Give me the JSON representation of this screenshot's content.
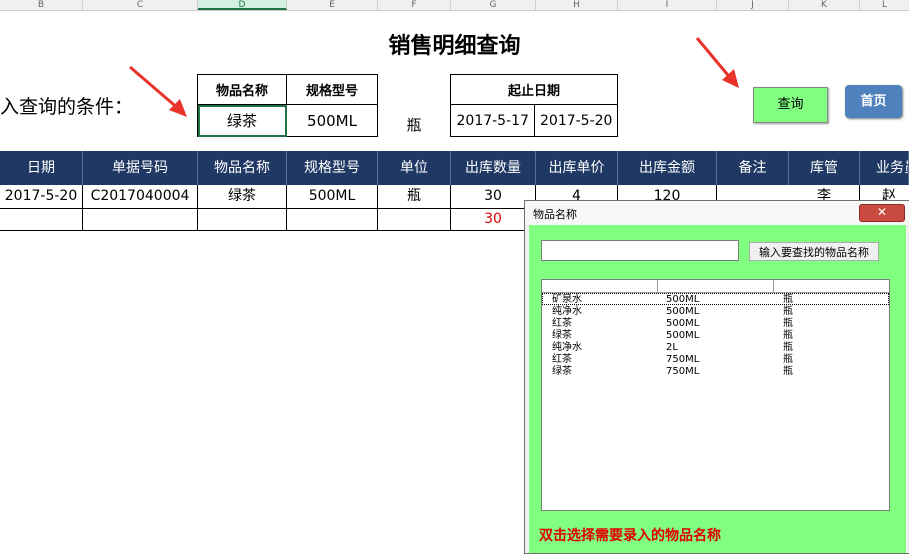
{
  "column_letters": [
    "B",
    "C",
    "D",
    "E",
    "F",
    "G",
    "H",
    "I",
    "J",
    "K",
    "L"
  ],
  "title": "销售明细查询",
  "condition_label": "入查询的条件：",
  "criteria": {
    "product_name_header": "物品名称",
    "spec_header": "规格型号",
    "product_name_value": "绿茶",
    "spec_value": "500ML",
    "unit_value": "瓶",
    "date_range_header": "起止日期",
    "start_date": "2017-5-17",
    "end_date": "2017-5-20"
  },
  "buttons": {
    "query": "查询",
    "home": "首页"
  },
  "table": {
    "headers": [
      "日期",
      "单据号码",
      "物品名称",
      "规格型号",
      "单位",
      "出库数量",
      "出库单价",
      "出库金额",
      "备注",
      "库管",
      "业务员"
    ],
    "rows": [
      [
        "2017-5-20",
        "C2017040004",
        "绿茶",
        "500ML",
        "瓶",
        "30",
        "4",
        "120",
        "",
        "李",
        "赵"
      ]
    ],
    "total_qty": "30"
  },
  "dialog": {
    "title": "物品名称",
    "close_label": "✕",
    "search_placeholder": "",
    "search_button": "输入要查找的物品名称",
    "items": [
      {
        "name": "矿泉水",
        "spec": "500ML",
        "unit": "瓶"
      },
      {
        "name": "纯净水",
        "spec": "500ML",
        "unit": "瓶"
      },
      {
        "name": "红茶",
        "spec": "500ML",
        "unit": "瓶"
      },
      {
        "name": "绿茶",
        "spec": "500ML",
        "unit": "瓶"
      },
      {
        "name": "纯净水",
        "spec": "2L",
        "unit": "瓶"
      },
      {
        "name": "红茶",
        "spec": "750ML",
        "unit": "瓶"
      },
      {
        "name": "绿茶",
        "spec": "750ML",
        "unit": "瓶"
      }
    ],
    "hint": "双击选择需要录入的物品名称"
  },
  "colors": {
    "header_bg": "#1f3864",
    "query_button": "#80ff80",
    "home_button": "#4f81bd",
    "dialog_body": "#80ff80",
    "hint_text": "#e00000",
    "arrow": "#e8322a"
  }
}
